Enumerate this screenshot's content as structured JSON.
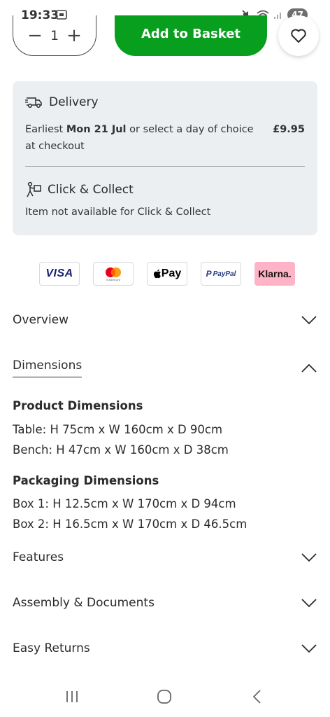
{
  "status": {
    "time": "19:33",
    "battery": "47"
  },
  "purchase": {
    "qty_minus": "−",
    "qty_value": "1",
    "qty_plus": "+",
    "add_to_basket": "Add to Basket"
  },
  "delivery": {
    "title": "Delivery",
    "text_prefix": "Earliest ",
    "text_date": "Mon 21 Jul",
    "text_suffix": " or select a day of choice at checkout",
    "price": "£9.95"
  },
  "collect": {
    "title": "Click & Collect",
    "text": "Item not available for Click & Collect"
  },
  "payments": [
    "VISA",
    "mastercard",
    "Pay",
    "PayPal",
    "Klarna."
  ],
  "accordion": {
    "overview": "Overview",
    "dimensions": "Dimensions",
    "features": "Features",
    "assembly": "Assembly & Documents",
    "returns": "Easy Returns"
  },
  "dimensions": {
    "product_heading": "Product Dimensions",
    "product_lines": [
      "Table: H 75cm x W 160cm x D 90cm",
      "Bench: H 47cm x W 160cm x D 38cm"
    ],
    "packaging_heading": "Packaging Dimensions",
    "packaging_lines": [
      "Box 1: H 12.5cm x W 170cm x D 94cm",
      "Box 2: H 16.5cm x W 170cm x D 46.5cm"
    ]
  },
  "colors": {
    "accent_green": "#089e1e",
    "panel_grey": "#eceff1",
    "klarna_pink": "#ffb3c7"
  }
}
